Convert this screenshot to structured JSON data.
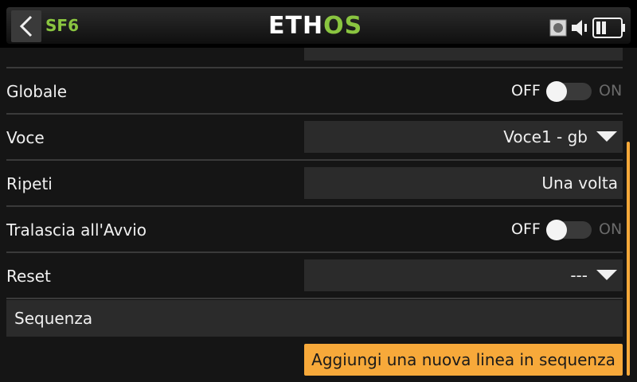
{
  "header": {
    "back_icon": "chevron-left-icon",
    "title": "SF6",
    "logo_prefix": "ETH",
    "logo_accent": "OS",
    "status_icons": [
      "record-icon",
      "speaker-icon",
      "battery-icon"
    ]
  },
  "rows": {
    "globale": {
      "label": "Globale",
      "off": "OFF",
      "on": "ON"
    },
    "voce": {
      "label": "Voce",
      "value": "Voce1 - gb"
    },
    "ripeti": {
      "label": "Ripeti",
      "value": "Una volta"
    },
    "tralascia": {
      "label": "Tralascia all'Avvio",
      "off": "OFF",
      "on": "ON"
    },
    "reset": {
      "label": "Reset",
      "value": "---"
    }
  },
  "sequence": {
    "label": "Sequenza",
    "add_button": "Aggiungi una nuova linea in sequenza"
  },
  "colors": {
    "accent_green": "#8ac540",
    "accent_orange": "#f7a93a"
  }
}
